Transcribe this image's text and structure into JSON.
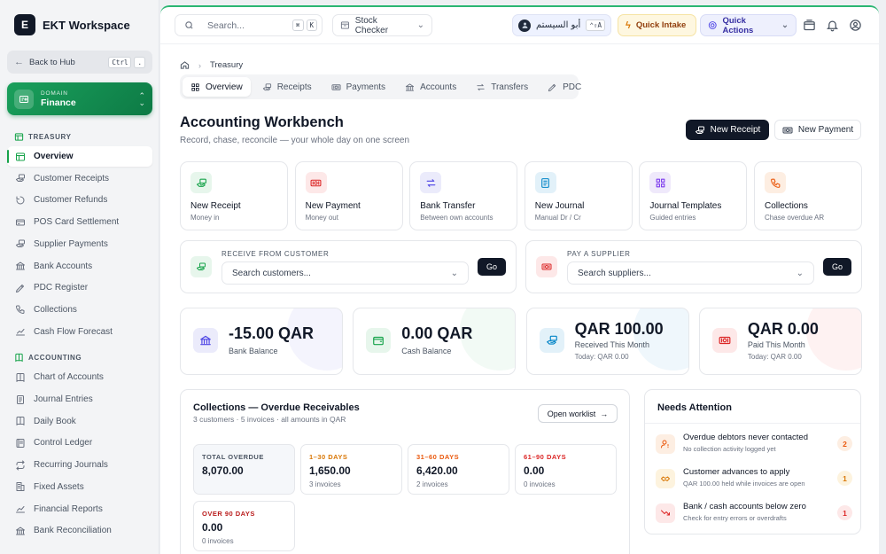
{
  "brand": {
    "logo_letter": "E",
    "name": "EKT Workspace"
  },
  "sidebar": {
    "back": {
      "label": "Back to Hub",
      "key1": "Ctrl",
      "key2": "."
    },
    "domain": {
      "label": "DOMAIN",
      "value": "Finance"
    },
    "sections": [
      {
        "title": "TREASURY",
        "items": [
          {
            "label": "Overview",
            "icon": "layout-icon",
            "active": true
          },
          {
            "label": "Customer Receipts",
            "icon": "money-hand-icon"
          },
          {
            "label": "Customer Refunds",
            "icon": "refund-icon"
          },
          {
            "label": "POS Card Settlement",
            "icon": "card-icon"
          },
          {
            "label": "Supplier Payments",
            "icon": "money-hand-icon"
          },
          {
            "label": "Bank Accounts",
            "icon": "bank-icon"
          },
          {
            "label": "PDC Register",
            "icon": "pen-icon"
          },
          {
            "label": "Collections",
            "icon": "phone-icon"
          },
          {
            "label": "Cash Flow Forecast",
            "icon": "chart-icon"
          }
        ]
      },
      {
        "title": "ACCOUNTING",
        "items": [
          {
            "label": "Chart of Accounts",
            "icon": "book-icon"
          },
          {
            "label": "Journal Entries",
            "icon": "journal-icon"
          },
          {
            "label": "Daily Book",
            "icon": "book-icon"
          },
          {
            "label": "Control Ledger",
            "icon": "ledger-icon"
          },
          {
            "label": "Recurring Journals",
            "icon": "repeat-icon"
          },
          {
            "label": "Fixed Assets",
            "icon": "building-icon"
          },
          {
            "label": "Financial Reports",
            "icon": "chart-icon"
          },
          {
            "label": "Bank Reconciliation",
            "icon": "bank-icon"
          }
        ]
      }
    ]
  },
  "topbar": {
    "search": {
      "placeholder": "Search...",
      "key1": "⌘",
      "key2": "K"
    },
    "app_select": "Stock Checker",
    "user": {
      "name": "أبو السيستم",
      "key": "⌃⇧A"
    },
    "quick_intake": "Quick Intake",
    "quick_actions": "Quick Actions"
  },
  "breadcrumb": {
    "current": "Treasury"
  },
  "tabs": [
    {
      "label": "Overview",
      "icon": "grid-icon",
      "active": true
    },
    {
      "label": "Receipts",
      "icon": "money-hand-icon"
    },
    {
      "label": "Payments",
      "icon": "cash-icon"
    },
    {
      "label": "Accounts",
      "icon": "bank-icon"
    },
    {
      "label": "Transfers",
      "icon": "transfer-icon"
    },
    {
      "label": "PDC",
      "icon": "pen-icon"
    }
  ],
  "header": {
    "title": "Accounting Workbench",
    "subtitle": "Record, chase, reconcile — your whole day on one screen",
    "primary_button": "New Receipt",
    "secondary_button": "New Payment"
  },
  "action_cards": [
    {
      "title": "New Receipt",
      "sub": "Money in",
      "icon": "money-hand-icon",
      "color": "#16a34a",
      "bg": "#e7f6ec"
    },
    {
      "title": "New Payment",
      "sub": "Money out",
      "icon": "cash-icon",
      "color": "#dc2626",
      "bg": "#fde8e8"
    },
    {
      "title": "Bank Transfer",
      "sub": "Between own accounts",
      "icon": "transfer-icon",
      "color": "#4f46e5",
      "bg": "#ebebfb"
    },
    {
      "title": "New Journal",
      "sub": "Manual Dr / Cr",
      "icon": "journal-icon",
      "color": "#0284c7",
      "bg": "#e2f1f9"
    },
    {
      "title": "Journal Templates",
      "sub": "Guided entries",
      "icon": "grid-icon",
      "color": "#7c3aed",
      "bg": "#efe9fb"
    },
    {
      "title": "Collections",
      "sub": "Chase overdue AR",
      "icon": "phone-icon",
      "color": "#ea580c",
      "bg": "#fdeee2"
    }
  ],
  "receive": {
    "label": "RECEIVE FROM CUSTOMER",
    "placeholder": "Search customers...",
    "go": "Go"
  },
  "pay": {
    "label": "PAY A SUPPLIER",
    "placeholder": "Search suppliers...",
    "go": "Go"
  },
  "stats": [
    {
      "value": "-15.00 QAR",
      "label": "Bank Balance",
      "sub": "",
      "icon": "bank-icon",
      "color": "#4f46e5",
      "bg": "#ebebfb"
    },
    {
      "value": "0.00 QAR",
      "label": "Cash Balance",
      "sub": "",
      "icon": "wallet-icon",
      "color": "#16a34a",
      "bg": "#e7f6ec"
    },
    {
      "value": "QAR 100.00",
      "label": "Received This Month",
      "sub": "Today: QAR 0.00",
      "icon": "money-hand-icon",
      "color": "#0284c7",
      "bg": "#e2f1f9"
    },
    {
      "value": "QAR 0.00",
      "label": "Paid This Month",
      "sub": "Today: QAR 0.00",
      "icon": "cash-icon",
      "color": "#dc2626",
      "bg": "#fde8e8"
    }
  ],
  "collections": {
    "title": "Collections — Overdue Receivables",
    "subtitle": "3 customers · 5 invoices · all amounts in QAR",
    "open_button": "Open worklist",
    "buckets": [
      {
        "label": "TOTAL OVERDUE",
        "value": "8,070.00",
        "sub": "",
        "color": "#4b5563"
      },
      {
        "label": "1–30 DAYS",
        "value": "1,650.00",
        "sub": "3 invoices",
        "color": "#d97706"
      },
      {
        "label": "31–60 DAYS",
        "value": "6,420.00",
        "sub": "2 invoices",
        "color": "#ea580c"
      },
      {
        "label": "61–90 DAYS",
        "value": "0.00",
        "sub": "0 invoices",
        "color": "#dc2626"
      },
      {
        "label": "OVER 90 DAYS",
        "value": "0.00",
        "sub": "0 invoices",
        "color": "#b91c1c"
      }
    ]
  },
  "attention": {
    "title": "Needs Attention",
    "items": [
      {
        "title": "Overdue debtors never contacted",
        "sub": "No collection activity logged yet",
        "count": "2",
        "icon": "user-alert-icon",
        "color": "#ea580c",
        "bg": "#fdeee2"
      },
      {
        "title": "Customer advances to apply",
        "sub": "QAR 100.00 held while invoices are open",
        "count": "1",
        "icon": "handshake-icon",
        "color": "#d97706",
        "bg": "#fdf3de"
      },
      {
        "title": "Bank / cash accounts below zero",
        "sub": "Check for entry errors or overdrafts",
        "count": "1",
        "icon": "trend-down-icon",
        "color": "#dc2626",
        "bg": "#fde8e8"
      }
    ]
  }
}
